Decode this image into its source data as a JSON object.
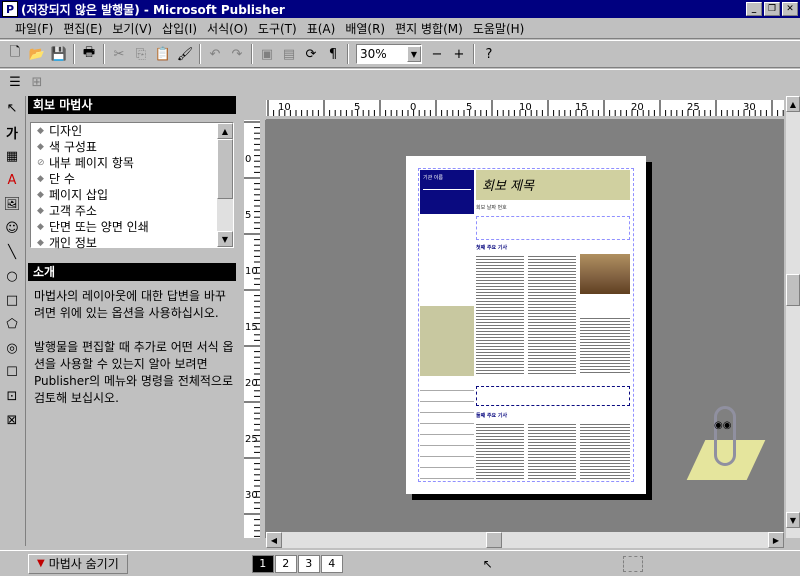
{
  "titlebar": {
    "title": "(저장되지 않은 발행물) - Microsoft Publisher"
  },
  "menu": [
    "파일(F)",
    "편집(E)",
    "보기(V)",
    "삽입(I)",
    "서식(O)",
    "도구(T)",
    "표(A)",
    "배열(R)",
    "편지 병합(M)",
    "도움말(H)"
  ],
  "toolbar": {
    "zoom": "30%"
  },
  "wizard": {
    "title": "회보 마법사",
    "items": [
      "디자인",
      "색 구성표",
      "내부 페이지 항목",
      "단 수",
      "페이지 삽입",
      "고객 주소",
      "단면 또는 양면 인쇄",
      "개인 정보"
    ],
    "intro_title": "소개",
    "intro_p1": "마법사의 레이아웃에 대한 답변을 바꾸려면 위에 있는 옵션을 사용하십시오.",
    "intro_p2": "발행물을 편집할 때 추가로 어떤 서식 옵션을 사용할 수 있는지 알아 보려면 Publisher의 메뉴와 명령을 전체적으로 검토해 보십시오."
  },
  "ruler": {
    "h_labels": [
      "10",
      "5",
      "0",
      "5",
      "10",
      "15",
      "20",
      "25",
      "30"
    ],
    "v_labels": [
      "0",
      "5",
      "10",
      "15",
      "20",
      "25",
      "30"
    ]
  },
  "document": {
    "title": "회보 제목",
    "subtitle": "회보 날짜 번호",
    "story1": "첫째 주요 기사",
    "story2": "둘째 주요 기사",
    "header_box": "기관 이름"
  },
  "statusbar": {
    "hide_wizard": "마법사 숨기기",
    "pages": [
      "1",
      "2",
      "3",
      "4"
    ]
  }
}
